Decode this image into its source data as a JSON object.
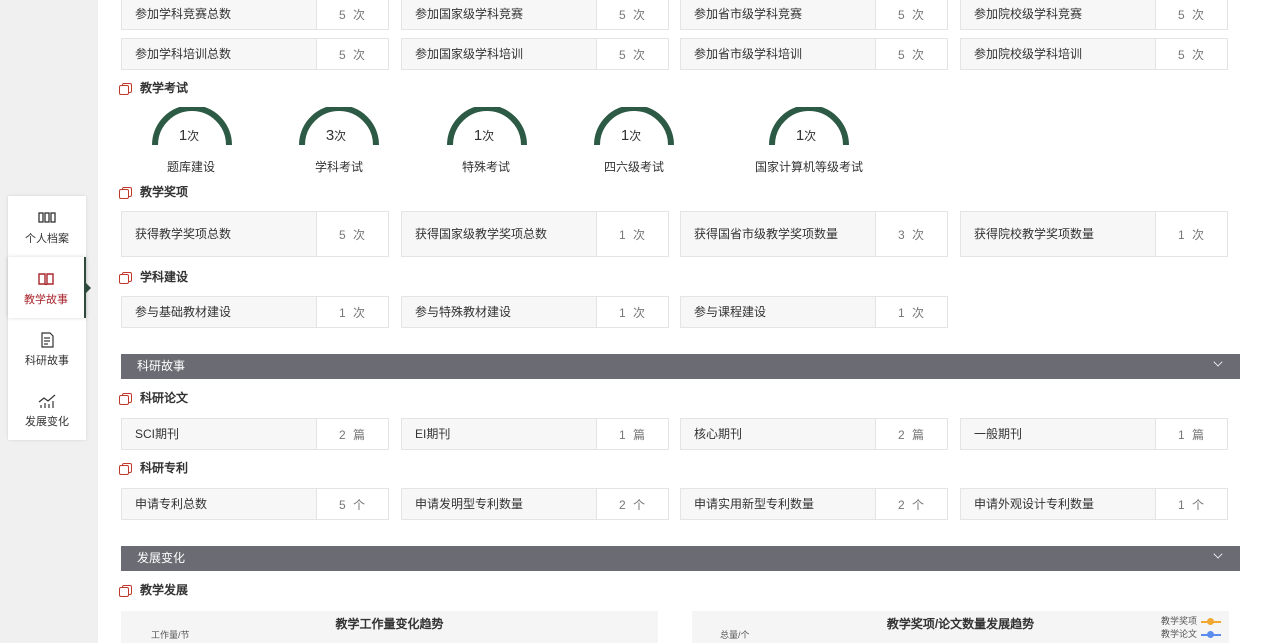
{
  "sidebar": {
    "items": [
      {
        "label": "个人档案",
        "icon": "bars-icon"
      },
      {
        "label": "教学故事",
        "icon": "book-icon"
      },
      {
        "label": "科研故事",
        "icon": "document-icon"
      },
      {
        "label": "发展变化",
        "icon": "trend-chart-icon"
      }
    ],
    "active": 1
  },
  "competition": {
    "row1": [
      {
        "label": "参加学科竞赛总数",
        "value": "5 次"
      },
      {
        "label": "参加国家级学科竞赛",
        "value": "5 次"
      },
      {
        "label": "参加省市级学科竞赛",
        "value": "5 次"
      },
      {
        "label": "参加院校级学科竞赛",
        "value": "5 次"
      }
    ],
    "row2": [
      {
        "label": "参加学科培训总数",
        "value": "5 次"
      },
      {
        "label": "参加国家级学科培训",
        "value": "5 次"
      },
      {
        "label": "参加省市级学科培训",
        "value": "5 次"
      },
      {
        "label": "参加院校级学科培训",
        "value": "5 次"
      }
    ]
  },
  "exam": {
    "title": "教学考试",
    "gauges": [
      {
        "num": "1",
        "unit": "次",
        "label": "题库建设"
      },
      {
        "num": "3",
        "unit": "次",
        "label": "学科考试"
      },
      {
        "num": "1",
        "unit": "次",
        "label": "特殊考试"
      },
      {
        "num": "1",
        "unit": "次",
        "label": "四六级考试"
      },
      {
        "num": "1",
        "unit": "次",
        "label": "国家计算机等级考试"
      }
    ]
  },
  "awards": {
    "title": "教学奖项",
    "items": [
      {
        "label": "获得教学奖项总数",
        "value": "5 次"
      },
      {
        "label": "获得国家级教学奖项总数",
        "value": "1 次"
      },
      {
        "label": "获得国省市级教学奖项数量",
        "value": "3 次"
      },
      {
        "label": "获得院校教学奖项数量",
        "value": "1 次"
      }
    ]
  },
  "discipline": {
    "title": "学科建设",
    "items": [
      {
        "label": "参与基础教材建设",
        "value": "1 次"
      },
      {
        "label": "参与特殊教材建设",
        "value": "1 次"
      },
      {
        "label": "参与课程建设",
        "value": "1 次"
      }
    ]
  },
  "research": {
    "bar_title": "科研故事",
    "papers_title": "科研论文",
    "papers": [
      {
        "label": "SCI期刊",
        "value": "2 篇"
      },
      {
        "label": "EI期刊",
        "value": "1 篇"
      },
      {
        "label": "核心期刊",
        "value": "2 篇"
      },
      {
        "label": "一般期刊",
        "value": "1 篇"
      }
    ],
    "patents_title": "科研专利",
    "patents": [
      {
        "label": "申请专利总数",
        "value": "5 个"
      },
      {
        "label": "申请发明型专利数量",
        "value": "2 个"
      },
      {
        "label": "申请实用新型专利数量",
        "value": "2 个"
      },
      {
        "label": "申请外观设计专利数量",
        "value": "1 个"
      }
    ]
  },
  "development": {
    "bar_title": "发展变化",
    "sub_title": "教学发展",
    "chart1": {
      "title": "教学工作量变化趋势",
      "ylabel": "工作量/节"
    },
    "chart2": {
      "title": "教学奖项/论文数量发展趋势",
      "ylabel": "总量/个",
      "legend": [
        {
          "name": "教学奖项",
          "color": "#f0a830"
        },
        {
          "name": "教学论文",
          "color": "#5b8def"
        }
      ]
    }
  },
  "colors": {
    "gauge": "#2d5a45",
    "accent": "#a8262c",
    "bar": "#6b6c73"
  }
}
